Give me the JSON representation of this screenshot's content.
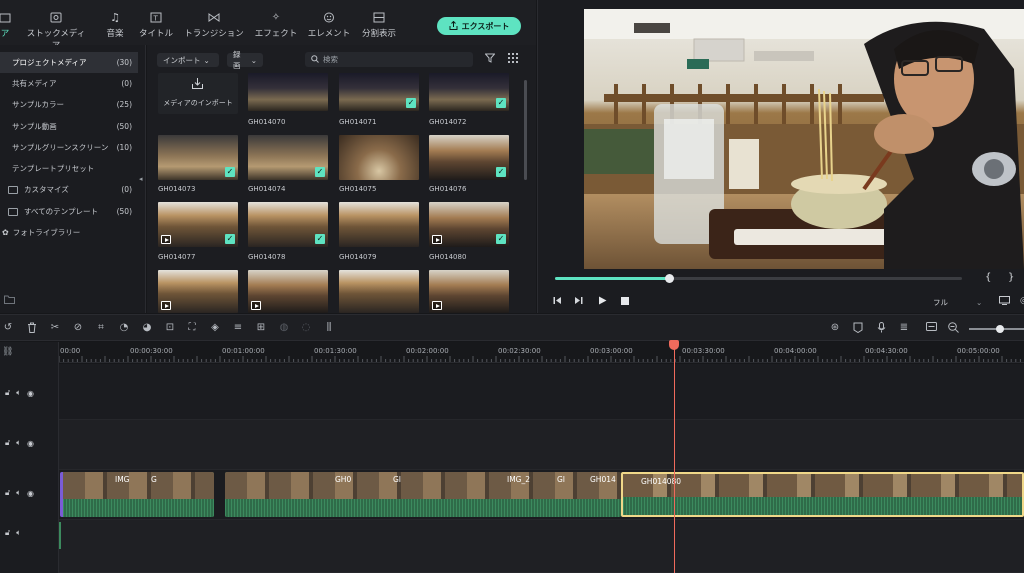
{
  "tabs": [
    {
      "label": "ア",
      "active": true,
      "icon": "folder-icon"
    },
    {
      "label": "ストックメディア",
      "active": false,
      "icon": "stock-media-icon"
    },
    {
      "label": "音楽",
      "active": false,
      "icon": "music-icon"
    },
    {
      "label": "タイトル",
      "active": false,
      "icon": "title-icon"
    },
    {
      "label": "トランジション",
      "active": false,
      "icon": "transition-icon"
    },
    {
      "label": "エフェクト",
      "active": false,
      "icon": "effect-icon"
    },
    {
      "label": "エレメント",
      "active": false,
      "icon": "element-icon"
    },
    {
      "label": "分割表示",
      "active": false,
      "icon": "split-screen-icon"
    }
  ],
  "export_label": "エクスポート",
  "sidebar": {
    "items": [
      {
        "label": "プロジェクトメディア",
        "count": "(30)",
        "selected": true
      },
      {
        "label": "共有メディア",
        "count": "(0)"
      },
      {
        "label": "サンプルカラー",
        "count": "(25)"
      },
      {
        "label": "サンプル動画",
        "count": "(50)"
      },
      {
        "label": "サンプルグリーンスクリーン",
        "count": "(10)"
      },
      {
        "label": "テンプレートプリセット",
        "count": ""
      },
      {
        "label": "カスタマイズ",
        "count": "(0)"
      },
      {
        "label": "すべてのテンプレート",
        "count": "(50)"
      },
      {
        "label": "フォトライブラリー",
        "count": ""
      }
    ]
  },
  "media": {
    "import_dropdown": "インポート",
    "record_dropdown": "録画",
    "search_placeholder": "検索",
    "import_tile": "メディアのインポート",
    "thumbs": [
      {
        "name": "GH014070",
        "checked": false,
        "video": false
      },
      {
        "name": "GH014071",
        "checked": true,
        "video": false
      },
      {
        "name": "GH014072",
        "checked": true,
        "video": false
      },
      {
        "name": "GH014073",
        "checked": true,
        "video": false
      },
      {
        "name": "GH014074",
        "checked": true,
        "video": false
      },
      {
        "name": "GH014075",
        "checked": false,
        "video": false
      },
      {
        "name": "GH014076",
        "checked": true,
        "video": false
      },
      {
        "name": "GH014077",
        "checked": true,
        "video": true
      },
      {
        "name": "GH014078",
        "checked": true,
        "video": true
      },
      {
        "name": "GH014079",
        "checked": false,
        "video": true
      },
      {
        "name": "GH014080",
        "checked": true,
        "video": true
      }
    ]
  },
  "preview": {
    "progress": 0.28,
    "zoom": "フル",
    "brace_open": "{",
    "brace_close": "}"
  },
  "ruler": {
    "labels": [
      "00:00",
      "00:00:30:00",
      "00:01:00:00",
      "00:01:30:00",
      "00:02:00:00",
      "00:02:30:00",
      "00:03:00:00",
      "00:03:30:00",
      "00:04:00:00",
      "00:04:30:00",
      "00:05:00:00"
    ]
  },
  "clips": [
    "IMG",
    "G",
    "GH0",
    "GI",
    "IMG_2",
    "GI",
    "GH014",
    "GH014080"
  ]
}
